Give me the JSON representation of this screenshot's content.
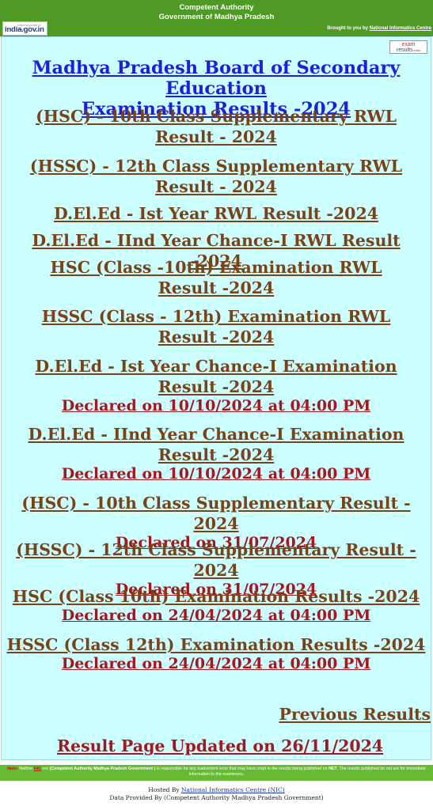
{
  "header": {
    "line1": "Competent Authority",
    "line2": "Government of Madhya Pradesh",
    "logo_main": "india.gov.in",
    "logo_small": "national portal of india",
    "brought_prefix": "Brought to you by",
    "brought_link": "National Informatics Centre"
  },
  "exams_logo": {
    "top": "exam",
    "bottom": "results",
    "suffix": ".india"
  },
  "title": {
    "line1": "Madhya Pradesh Board of Secondary Education",
    "line2": "Examination Results -2024"
  },
  "results": [
    {
      "label": "(HSC) - 10th Class Supplementary RWL Result - 2024",
      "declared": ""
    },
    {
      "label": "(HSSC) - 12th Class Supplementary RWL Result - 2024",
      "declared": ""
    },
    {
      "label": "D.El.Ed - Ist Year RWL Result -2024",
      "declared": ""
    },
    {
      "label": "D.El.Ed - IInd Year Chance-I RWL Result -2024",
      "declared": ""
    },
    {
      "label": "HSC (Class -10th) Examination RWL Result -2024",
      "declared": ""
    },
    {
      "label": "HSSC (Class - 12th) Examination RWL Result -2024",
      "declared": ""
    },
    {
      "label": "D.El.Ed - Ist Year Chance-I Examination Result -2024",
      "declared": "Declared on 10/10/2024 at 04:00 PM"
    },
    {
      "label": "D.El.Ed - IInd Year Chance-I Examination Result -2024",
      "declared": "Declared on 10/10/2024 at 04:00 PM"
    },
    {
      "label": "(HSC) - 10th Class Supplementary Result - 2024",
      "declared": "Declared on 31/07/2024"
    },
    {
      "label": "(HSSC) - 12th Class Supplementary Result - 2024",
      "declared": "Declared on 31/07/2024"
    },
    {
      "label": "HSC (Class 10th) Examination Results -2024",
      "declared": "Declared on 24/04/2024 at 04:00 PM"
    },
    {
      "label": "HSSC (Class 12th) Examination Results -2024",
      "declared": "Declared on 24/04/2024 at 04:00 PM"
    }
  ],
  "previous_results": "Previous Results",
  "updated": "Result Page Updated on 26/11/2024",
  "note": {
    "label": "Note:",
    "neither": "Neither",
    "nic": "NIC",
    "nor": "nor",
    "authority": "(Competent Authority Madhya Pradesh  Government )",
    "text1": "is responsible for any inadvertent error that may have crept in the results being published on",
    "net": "NET",
    "text2": ". The results published on net are for immediate information to the examinees."
  },
  "footer": {
    "hosted_prefix": "Hosted By",
    "hosted_link": "National Informatics Centre (NIC)",
    "provided": "Data Provided By (Competent Authority Madhya Pradesh Government)"
  }
}
